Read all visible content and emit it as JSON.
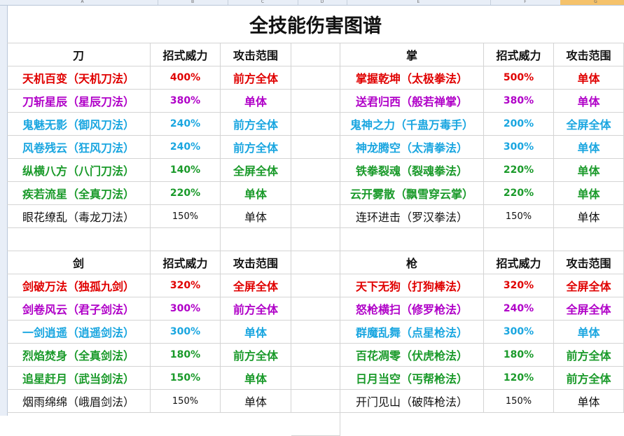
{
  "column_headers": [
    "A",
    "B",
    "C",
    "D",
    "E",
    "F",
    "G"
  ],
  "title": "全技能伤害图谱",
  "colors": {
    "red": "#e00000",
    "purple": "#b000c8",
    "cyan": "#1aa6e0",
    "green": "#1a9a2a",
    "dark": "#111111"
  },
  "sections": [
    {
      "side": "left",
      "header": [
        "刀",
        "招式威力",
        "攻击范围"
      ],
      "rows": [
        {
          "name": "天机百变（天机刀法）",
          "power": "400%",
          "range": "前方全体",
          "color": "red"
        },
        {
          "name": "刀斩星辰（星辰刀法）",
          "power": "380%",
          "range": "单体",
          "color": "purple"
        },
        {
          "name": "鬼魅无影（御风刀法）",
          "power": "240%",
          "range": "前方全体",
          "color": "cyan"
        },
        {
          "name": "风卷残云（狂风刀法）",
          "power": "240%",
          "range": "前方全体",
          "color": "cyan"
        },
        {
          "name": "纵横八方（八门刀法）",
          "power": "140%",
          "range": "全屏全体",
          "color": "green"
        },
        {
          "name": "疾若流星（全真刀法）",
          "power": "220%",
          "range": "单体",
          "color": "green"
        },
        {
          "name": "眼花缭乱（毒龙刀法）",
          "power": "150%",
          "range": "单体",
          "color": "dark"
        }
      ]
    },
    {
      "side": "right",
      "header": [
        "掌",
        "招式威力",
        "攻击范围"
      ],
      "rows": [
        {
          "name": "掌握乾坤（太极拳法）",
          "power": "500%",
          "range": "单体",
          "color": "red"
        },
        {
          "name": "送君归西（般若禅掌）",
          "power": "380%",
          "range": "单体",
          "color": "purple"
        },
        {
          "name": "鬼神之力（千蛊万毒手）",
          "power": "200%",
          "range": "全屏全体",
          "color": "cyan"
        },
        {
          "name": "神龙腾空（太清拳法）",
          "power": "300%",
          "range": "单体",
          "color": "cyan"
        },
        {
          "name": "铁拳裂魂（裂魂拳法）",
          "power": "220%",
          "range": "单体",
          "color": "green"
        },
        {
          "name": "云开雾散（飘雪穿云掌）",
          "power": "220%",
          "range": "单体",
          "color": "green"
        },
        {
          "name": "连环进击（罗汉拳法）",
          "power": "150%",
          "range": "单体",
          "color": "dark"
        }
      ]
    },
    {
      "side": "left",
      "header": [
        "剑",
        "招式威力",
        "攻击范围"
      ],
      "rows": [
        {
          "name": "剑破万法（独孤九剑）",
          "power": "320%",
          "range": "全屏全体",
          "color": "red"
        },
        {
          "name": "剑卷风云（君子剑法）",
          "power": "300%",
          "range": "前方全体",
          "color": "purple"
        },
        {
          "name": "一剑逍遥（逍遥剑法）",
          "power": "300%",
          "range": "单体",
          "color": "cyan"
        },
        {
          "name": "烈焰焚身（全真剑法）",
          "power": "180%",
          "range": "前方全体",
          "color": "green"
        },
        {
          "name": "追星赶月（武当剑法）",
          "power": "150%",
          "range": "单体",
          "color": "green"
        },
        {
          "name": "烟雨绵绵（峨眉剑法）",
          "power": "150%",
          "range": "单体",
          "color": "dark"
        }
      ]
    },
    {
      "side": "right",
      "header": [
        "枪",
        "招式威力",
        "攻击范围"
      ],
      "rows": [
        {
          "name": "天下无狗（打狗棒法）",
          "power": "320%",
          "range": "全屏全体",
          "color": "red"
        },
        {
          "name": "怒枪横扫（修罗枪法）",
          "power": "240%",
          "range": "全屏全体",
          "color": "purple"
        },
        {
          "name": "群魔乱舞（点星枪法）",
          "power": "300%",
          "range": "单体",
          "color": "cyan"
        },
        {
          "name": "百花凋零（伏虎枪法）",
          "power": "180%",
          "range": "前方全体",
          "color": "green"
        },
        {
          "name": "日月当空（丐帮枪法）",
          "power": "120%",
          "range": "前方全体",
          "color": "green"
        },
        {
          "name": "开门见山（破阵枪法）",
          "power": "150%",
          "range": "单体",
          "color": "dark"
        }
      ]
    }
  ]
}
